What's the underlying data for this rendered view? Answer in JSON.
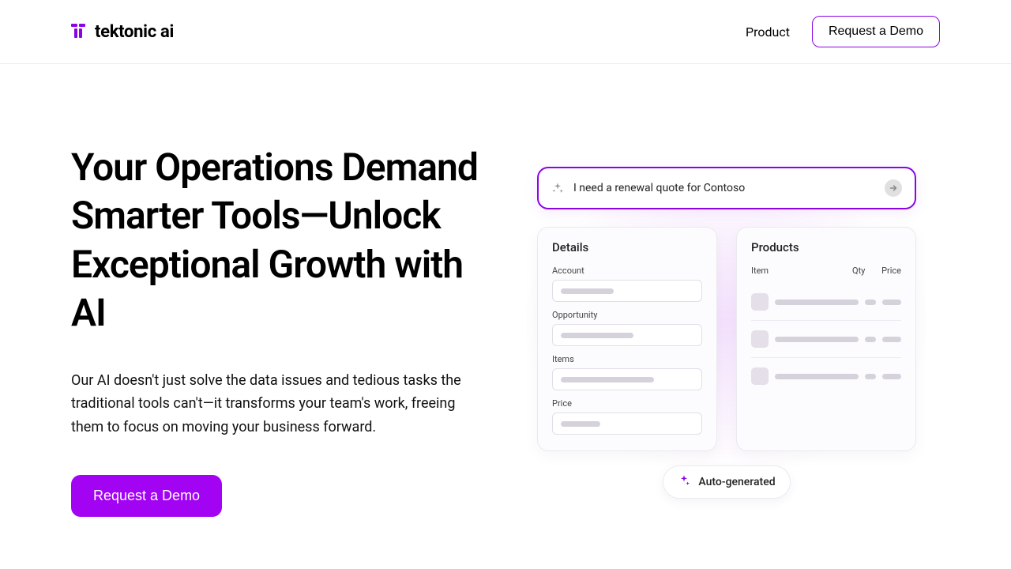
{
  "brand": {
    "name": "tektonic ai",
    "accent": "#8b04e5"
  },
  "nav": {
    "product": "Product",
    "demo": "Request a Demo"
  },
  "hero": {
    "headline": "Your Operations Demand Smarter Tools—Unlock Exceptional Growth with AI",
    "subhead": "Our AI doesn't just solve the data issues and tedious tasks the traditional tools can't—it transforms your team's work, freeing them to focus on moving your business forward.",
    "cta": "Request a Demo"
  },
  "illustration": {
    "prompt": "I need a renewal quote for Contoso",
    "details": {
      "title": "Details",
      "fields": [
        "Account",
        "Opportunity",
        "Items",
        "Price"
      ]
    },
    "products": {
      "title": "Products",
      "columns": [
        "Item",
        "Qty",
        "Price"
      ]
    },
    "autogen_label": "Auto-generated"
  }
}
